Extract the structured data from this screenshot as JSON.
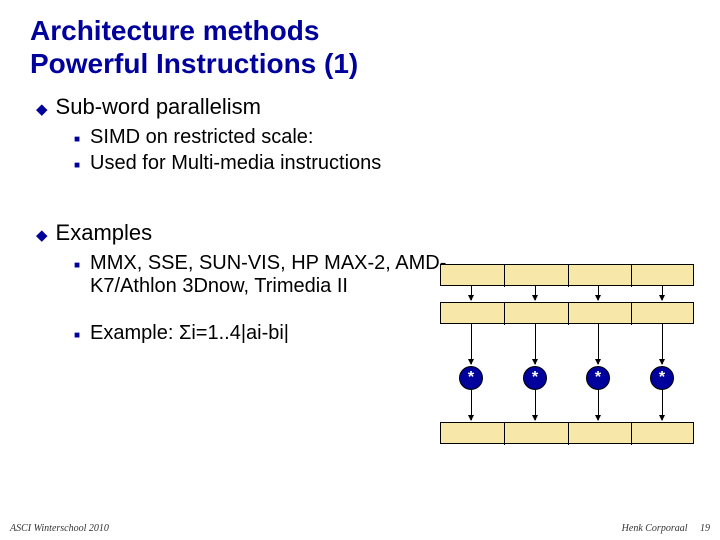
{
  "title_line1": "Architecture methods",
  "title_line2": "Powerful Instructions (1)",
  "bullets": {
    "subword": "Sub-word parallelism",
    "simd": "SIMD on restricted scale:",
    "multimedia": "Used for Multi-media instructions",
    "examples": "Examples",
    "exlist": "MMX, SSE, SUN-VIS, HP MAX-2, AMD-K7/Athlon 3Dnow, Trimedia II",
    "exsum": "Example: Σi=1..4|ai-bi|"
  },
  "diagram": {
    "op_symbol": "*"
  },
  "footer": {
    "left": "ASCI Winterschool 2010",
    "right": "Henk Corporaal",
    "page": "19"
  }
}
